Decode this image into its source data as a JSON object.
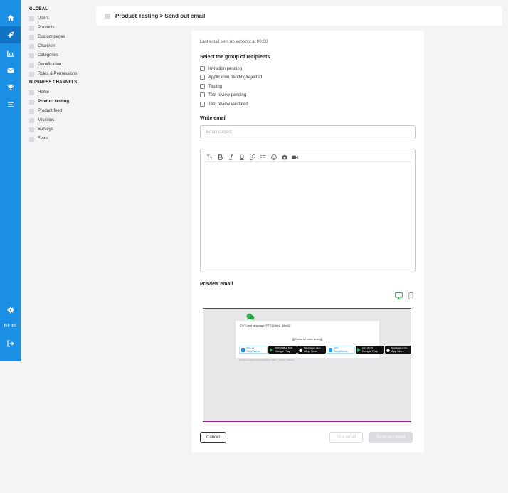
{
  "rail": {
    "icons": [
      "home-icon",
      "rocket-icon",
      "chart-icon",
      "mail-icon",
      "trophy-icon",
      "list-icon",
      "gear-icon",
      "logout-icon"
    ],
    "bottom_label": "BIP test",
    "accent": "#1a8fe3",
    "active_bg": "#1272c4"
  },
  "menu": {
    "global_heading": "GLOBAL",
    "global_items": [
      "Users",
      "Products",
      "Custom pages",
      "Channels",
      "Categories",
      "Gamification",
      "Roles & Permissions"
    ],
    "business_heading": "BUSINESS CHANNELS",
    "business_items": [
      "Home",
      "Product testing",
      "Product feed",
      "Missions",
      "Surveys",
      "Event"
    ],
    "active_item": "Product testing"
  },
  "topbar": {
    "title": "Product Testing > Send out email"
  },
  "form": {
    "last_sent": "Last email sent on xx/xx/xx at 00:00",
    "recipients_title": "Select the group of recipients",
    "recipients": [
      "Invitation pending",
      "Application pending/rejected",
      "Testing",
      "Test review pending",
      "Test review validated"
    ],
    "write_title": "Write email",
    "subject_value": "",
    "subject_placeholder": "Email subject",
    "toolbar_icons": [
      "text-size-icon",
      "bold-icon",
      "italic-icon",
      "underline-icon",
      "link-icon",
      "bullet-list-icon",
      "emoji-icon",
      "image-icon",
      "video-icon"
    ],
    "preview_title": "Preview email",
    "device_icons": [
      "desktop-icon",
      "mobile-icon"
    ]
  },
  "preview": {
    "line1": "[{%\"Cand language \"FT\"} {{title}} {{first}}]",
    "line2": "[{{Ecrire ici votre texte}}]",
    "badges": [
      {
        "top": "Offre sur",
        "bottom": "TobyWorks"
      },
      {
        "top": "DISPONIBLE SUR",
        "bottom": "Google Play"
      },
      {
        "top": "Télécharger dans",
        "bottom": "l'App Store"
      },
      {
        "top": "Offre",
        "bottom": "TobyWorks"
      },
      {
        "top": "GET IT ON",
        "bottom": "Google Play"
      },
      {
        "top": "Download on the",
        "bottom": "App Store"
      }
    ],
    "footer": "{{# Cand endtriconditionsOptions \"Sub\" = 'infoId', 'LOGO'}}",
    "frame_color": "#8b2a8f"
  },
  "actions": {
    "cancel": "Cancel",
    "test": "Test email",
    "send": "Send out email"
  }
}
